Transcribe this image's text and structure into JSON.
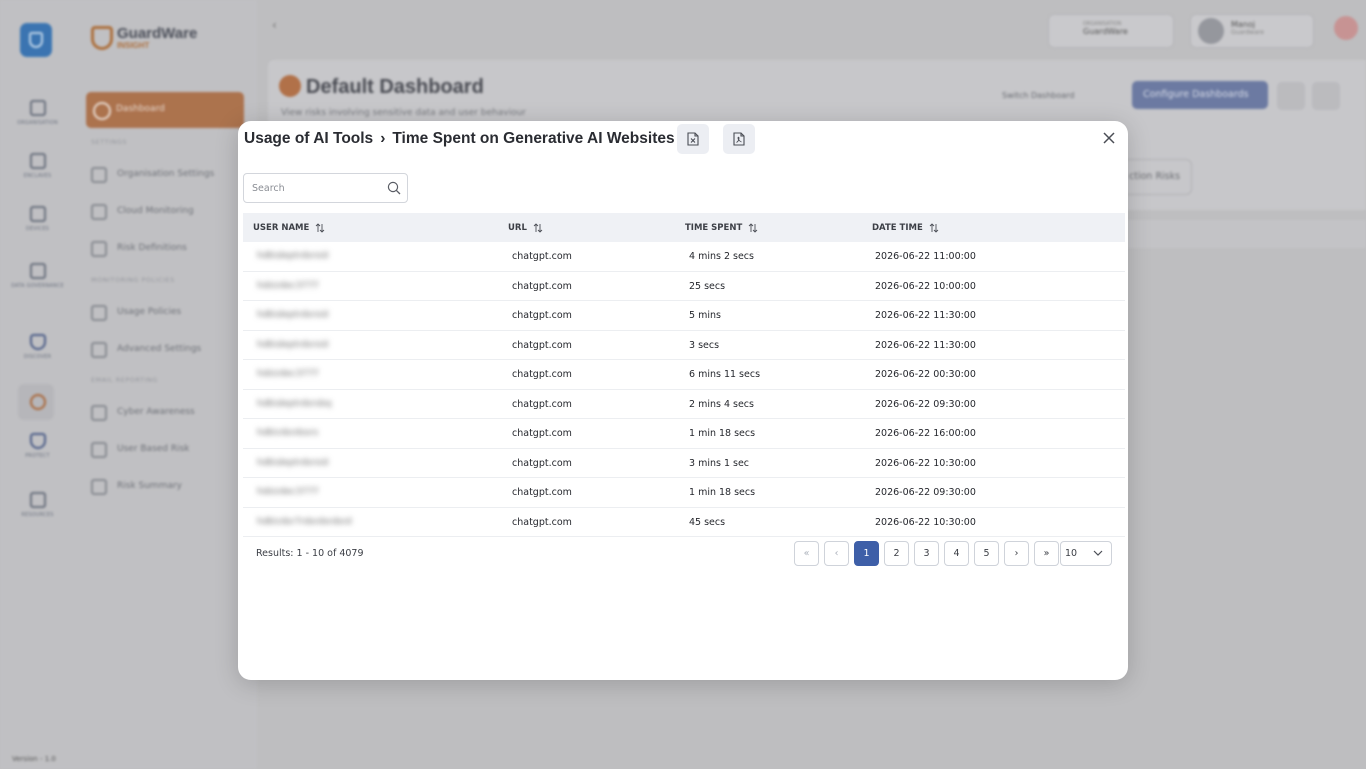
{
  "app": {
    "brand_name": "GuardWare",
    "brand_sub": "INSIGHT",
    "version": "Version - 1.0",
    "rail": [
      {
        "label": "ORGANISATION",
        "icon": "building-icon"
      },
      {
        "label": "ENCLAVES",
        "icon": "network-icon"
      },
      {
        "label": "DEVICES",
        "icon": "monitor-icon"
      },
      {
        "label": "DATA GOVERNANCE",
        "icon": "shield-icon"
      },
      {
        "label": "DISCOVER",
        "icon": "discover-icon"
      },
      {
        "label": "",
        "icon": "insight-icon"
      },
      {
        "label": "PROTECT",
        "icon": "protect-icon"
      },
      {
        "label": "RESOURCES",
        "icon": "cube-icon"
      }
    ],
    "sidebar": {
      "active": "Dashboard",
      "sections": [
        "SETTINGS",
        "MONITORING POLICIES",
        "EMAIL REPORTING"
      ],
      "items": [
        "Organisation Settings",
        "Cloud Monitoring",
        "Risk Definitions",
        "Usage Policies",
        "Advanced Settings",
        "Cyber Awareness",
        "User Based Risk",
        "Risk Summary"
      ]
    },
    "header": {
      "org_caption": "ORGANISATION",
      "org_name": "GuardWare",
      "user_name": "Manoj",
      "user_org": "Guardware"
    },
    "dashboard": {
      "title": "Default Dashboard",
      "subtitle": "View risks involving sensitive data and user behaviour",
      "switch_label": "Switch Dashboard",
      "configure_label": "Configure Dashboards",
      "risks_btn": "ction Risks"
    }
  },
  "modal": {
    "breadcrumb_parent": "Usage of AI Tools",
    "breadcrumb_separator": "›",
    "breadcrumb_current": "Time Spent on Generative AI Websites",
    "search_placeholder": "Search",
    "columns": [
      "USER NAME",
      "URL",
      "TIME SPENT",
      "DATE TIME"
    ],
    "rows": [
      {
        "user": "hdb\\deptrdsrsid",
        "url": "chatgpt.com",
        "time": "4 mins 2 secs",
        "date": "2026-06-22 11:00:00"
      },
      {
        "user": "hds\\rdec3777",
        "url": "chatgpt.com",
        "time": "25 secs",
        "date": "2026-06-22 10:00:00"
      },
      {
        "user": "hdb\\deptrdsrsid",
        "url": "chatgpt.com",
        "time": "5 mins",
        "date": "2026-06-22 11:30:00"
      },
      {
        "user": "hdb\\deptrdsrsid",
        "url": "chatgpt.com",
        "time": "3 secs",
        "date": "2026-06-22 11:30:00"
      },
      {
        "user": "hds\\rdec3777",
        "url": "chatgpt.com",
        "time": "6 mins 11 secs",
        "date": "2026-06-22 00:30:00"
      },
      {
        "user": "hdb\\deptrdsrsbq",
        "url": "chatgpt.com",
        "time": "2 mins 4 secs",
        "date": "2026-06-22 09:30:00"
      },
      {
        "user": "hdb\\rdsrdssrs",
        "url": "chatgpt.com",
        "time": "1 min 18 secs",
        "date": "2026-06-22 16:00:00"
      },
      {
        "user": "hdb\\deptrdsrsid",
        "url": "chatgpt.com",
        "time": "3 mins 1 sec",
        "date": "2026-06-22 10:30:00"
      },
      {
        "user": "hds\\rdec3777",
        "url": "chatgpt.com",
        "time": "1 min 18 secs",
        "date": "2026-06-22 09:30:00"
      },
      {
        "user": "hdb\\rdsr7rdsrdsrdsrd",
        "url": "chatgpt.com",
        "time": "45 secs",
        "date": "2026-06-22 10:30:00"
      }
    ],
    "results_text": "Results: 1 - 10 of 4079",
    "pagination": {
      "first": "«",
      "prev": "‹",
      "pages": [
        "1",
        "2",
        "3",
        "4",
        "5"
      ],
      "active_page": "1",
      "next": "›",
      "last": "»",
      "page_size": "10"
    }
  }
}
